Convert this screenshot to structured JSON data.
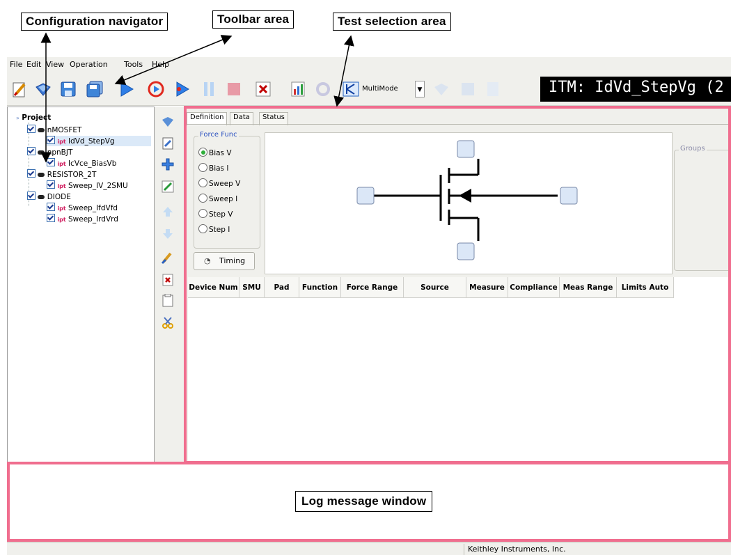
{
  "callouts": {
    "config_nav": "Configuration navigator",
    "toolbar": "Toolbar area",
    "test_selection": "Test selection area",
    "log": "Log message window"
  },
  "menu": [
    "File",
    "Edit",
    "View",
    "Operation",
    "Tools",
    "Help"
  ],
  "toolbar": {
    "multimode_label": "MultiMode",
    "title": "ITM: IdVd_StepVg (2"
  },
  "tree": {
    "root": "Project",
    "devices": [
      {
        "name": "nMOSFET",
        "tests": [
          "IdVd_StepVg"
        ]
      },
      {
        "name": "npnBJT",
        "tests": [
          "IcVce_BiasVb"
        ]
      },
      {
        "name": "RESISTOR_2T",
        "tests": [
          "Sweep_IV_2SMU"
        ]
      },
      {
        "name": "DIODE",
        "tests": [
          "Sweep_IfdVfd",
          "Sweep_IrdVrd"
        ]
      }
    ]
  },
  "tabs": [
    "Definition",
    "Data",
    "Status"
  ],
  "force_func": {
    "legend": "Force Func",
    "options": [
      "Bias V",
      "Bias I",
      "Sweep V",
      "Sweep I",
      "Step V",
      "Step I"
    ],
    "selected": "Bias V"
  },
  "groups_legend": "Groups",
  "timing_label": "Timing",
  "table_headers": [
    "Device Num",
    "SMU",
    "Pad",
    "Function",
    "Force Range",
    "Source",
    "Measure",
    "Compliance",
    "Meas Range",
    "Limits Auto"
  ],
  "status_text": "Keithley Instruments, Inc.",
  "colors": {
    "highlight": "#f06e8f",
    "accent": "#2a50c0",
    "title_bg": "#000000"
  }
}
